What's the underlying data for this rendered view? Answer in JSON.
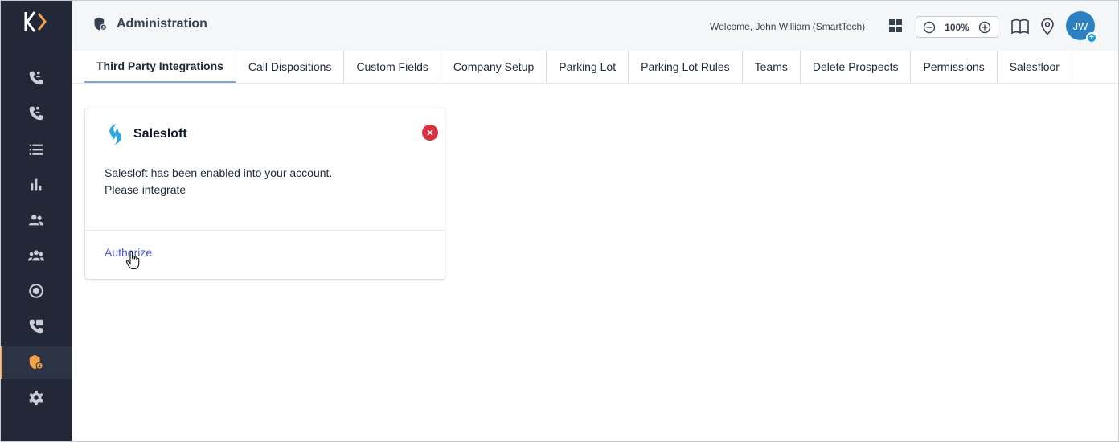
{
  "header": {
    "title": "Administration",
    "welcome": "Welcome, John William (SmartTech)",
    "zoom": "100%",
    "avatar_initials": "JW",
    "avatar_badge": "+"
  },
  "sidebar": {
    "items": [
      {
        "icon": "incoming-calls-icon"
      },
      {
        "icon": "outgoing-calls-icon"
      },
      {
        "icon": "list-icon"
      },
      {
        "icon": "bar-chart-icon"
      },
      {
        "icon": "contacts-icon"
      },
      {
        "icon": "team-icon"
      },
      {
        "icon": "record-icon"
      },
      {
        "icon": "call-transfer-icon"
      },
      {
        "icon": "admin-shield-icon",
        "active": true
      },
      {
        "icon": "gear-icon"
      }
    ]
  },
  "tabs": [
    {
      "label": "Third Party Integrations",
      "active": true
    },
    {
      "label": "Call Dispositions"
    },
    {
      "label": "Custom Fields"
    },
    {
      "label": "Company Setup"
    },
    {
      "label": "Parking Lot"
    },
    {
      "label": "Parking Lot Rules"
    },
    {
      "label": "Teams"
    },
    {
      "label": "Delete Prospects"
    },
    {
      "label": "Permissions"
    },
    {
      "label": "Salesfloor"
    }
  ],
  "card": {
    "title": "Salesloft",
    "line1": "Salesloft has been enabled into your account.",
    "line2": "Please integrate",
    "action": "Authorize",
    "close_symbol": "✕"
  },
  "colors": {
    "sidebar_bg": "#222838",
    "accent": "#f2a24a",
    "link": "#4a57d4",
    "close": "#d8323f",
    "avatar": "#2b7fc3"
  }
}
